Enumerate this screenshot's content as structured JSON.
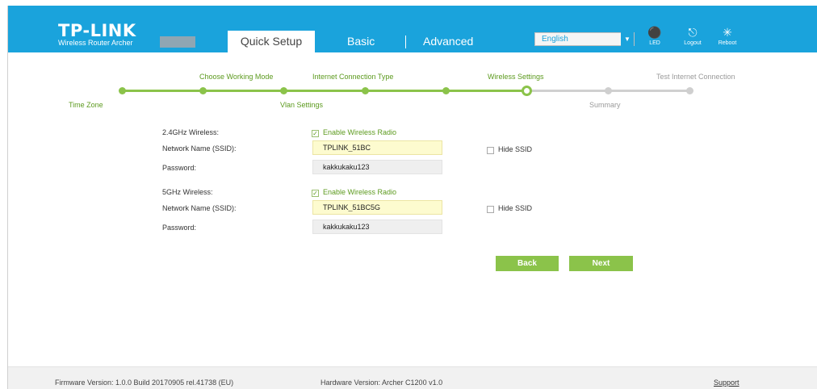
{
  "header": {
    "logo": "TP-LINK",
    "model": "Wireless Router Archer",
    "tabs": {
      "quick_setup": "Quick Setup",
      "basic": "Basic",
      "advanced": "Advanced"
    },
    "language": "English",
    "icons": {
      "led": "LED",
      "logout": "Logout",
      "reboot": "Reboot"
    },
    "brand_color": "#1aa3dc"
  },
  "steps": [
    {
      "label": "Time Zone",
      "state": "done"
    },
    {
      "label": "Choose Working Mode",
      "state": "done"
    },
    {
      "label": "Vlan Settings",
      "state": "done"
    },
    {
      "label": "Internet Connection Type",
      "state": "done"
    },
    {
      "label": "Wireless Settings",
      "state": "current"
    },
    {
      "label": "Summary",
      "state": "todo"
    },
    {
      "label": "Test Internet Connection",
      "state": "todo"
    }
  ],
  "wireless_24": {
    "label": "2.4GHz Wireless:",
    "enable_label": "Enable Wireless Radio",
    "enabled": true,
    "ssid_label": "Network Name (SSID):",
    "ssid": "TPLINK_51BC",
    "hide_ssid_label": "Hide SSID",
    "hide_ssid": false,
    "password_label": "Password:",
    "password": "kakkukaku123"
  },
  "wireless_5": {
    "label": "5GHz Wireless:",
    "enable_label": "Enable Wireless Radio",
    "enabled": true,
    "ssid_label": "Network Name (SSID):",
    "ssid": "TPLINK_51BC5G",
    "hide_ssid_label": "Hide SSID",
    "hide_ssid": false,
    "password_label": "Password:",
    "password": "kakkukaku123"
  },
  "buttons": {
    "back": "Back",
    "next": "Next"
  },
  "footer": {
    "firmware": "Firmware Version: 1.0.0 Build 20170905 rel.41738 (EU)",
    "hardware": "Hardware Version: Archer C1200 v1.0",
    "support": "Support"
  },
  "accent_color": "#8bc34a"
}
